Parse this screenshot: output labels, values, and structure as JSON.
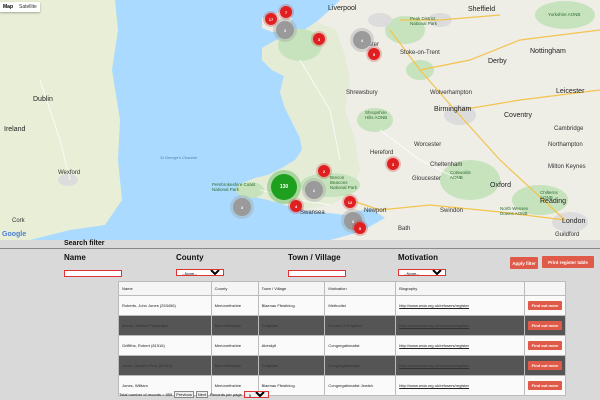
{
  "map": {
    "type_tabs": [
      "Map",
      "Satellite"
    ],
    "labels": {
      "liverpool": "Liverpool",
      "sheffield": "Sheffield",
      "peak_district": "Peak District National Park",
      "yorkshire_aonb": "Yorkshire AONB",
      "stoke": "Stoke-on-Trent",
      "nottingham": "Nottingham",
      "derby": "Derby",
      "leicester": "Leicester",
      "shrewsbury": "Shrewsbury",
      "birmingham": "Birmingham",
      "coventry": "Coventry",
      "dublin": "Dublin",
      "ireland": "Ireland",
      "wexford": "Wexford",
      "cork": "Cork",
      "worcester": "Worcester",
      "gloucester": "Gloucester",
      "cotswolds": "Cotswolds AONB",
      "oxford": "Oxford",
      "cheltenham": "Cheltenham",
      "swindon": "Swindon",
      "newport": "Newport",
      "reading": "Reading",
      "london": "London",
      "bath": "Bath",
      "st_georges_channel": "St George's Channel",
      "brecon": "Brecon Beacons National Park",
      "pembrokeshire": "Pembrokeshire Coast National Park",
      "shropshire": "Shropshire Hills AONB",
      "northampton": "Northampton",
      "cambridge": "Cambridge",
      "milton_keynes": "Milton Keynes",
      "hereford": "Hereford",
      "chester": "Chester",
      "chilterns": "Chilterns AONB",
      "north_wessex": "North Wessex Downs AONB",
      "swansea": "Swansea",
      "guildford": "Guildford",
      "wolverhampton": "Wolverhampton",
      "google": "Google"
    },
    "clusters": [
      "7",
      "17",
      "3",
      "3",
      "4",
      "5",
      "2",
      "3",
      "2",
      "130",
      "12",
      "3",
      "4",
      "3",
      "5"
    ]
  },
  "filter": {
    "title": "Search filter",
    "name_label": "Name",
    "county_label": "County",
    "county_value": "--None--",
    "town_label": "Town / Village",
    "motivation_label": "Motivation",
    "motivation_value": "--None--",
    "apply_button": "Apply filter",
    "print_button": "Print register table"
  },
  "table": {
    "headers": [
      "Name",
      "County",
      "Town / Village",
      "Motivation",
      "Biography",
      ""
    ],
    "rows": [
      {
        "name": "Roberts, John Jones (253456)",
        "county": "Merionethshire",
        "town": "Blaenau Ffestiniog",
        "motivation": "Methodist",
        "bio": "http://www.wcia.org.uk/refusers/register",
        "action": "Find out more",
        "shade": "light"
      },
      {
        "name": "Morris, William Foweraker",
        "county": "Merionethshire",
        "town": "Dolgellau",
        "motivation": "Church of England",
        "bio": "http://www.wcia.org.uk/refusers/register",
        "action": "Find out more",
        "shade": "dark"
      },
      {
        "name": "Griffiths, Robert (81516)",
        "county": "Merionethshire",
        "town": "Aberdyfi",
        "motivation": "Congregationalist",
        "bio": "http://www.wcia.org.uk/refusers/register",
        "action": "Find out more",
        "shade": "light"
      },
      {
        "name": "Hows, Daniel's Post (81521)",
        "county": "Merionethshire",
        "town": "Dolgellau",
        "motivation": "Congregationalist",
        "bio": "http://www.wcia.org.uk/refusers/register",
        "action": "Find out more",
        "shade": "dark"
      },
      {
        "name": "Jones, William",
        "county": "Merionethshire",
        "town": "Blaenau Ffestiniog",
        "motivation": "Congregationalist Jewish",
        "bio": "http://www.wcia.org.uk/refusers/register",
        "action": "Find out more",
        "shade": "light"
      }
    ]
  },
  "footer": {
    "total_text": "Total number of records = 855",
    "previous": "Previous",
    "next": "Next",
    "per_page_label": "Records per page",
    "per_page_value": "5"
  }
}
